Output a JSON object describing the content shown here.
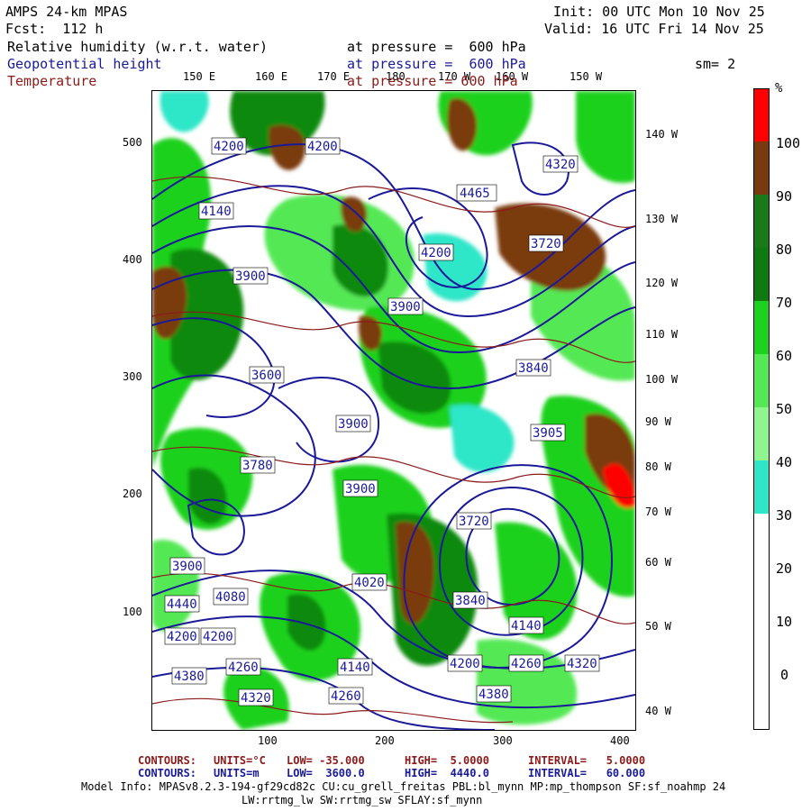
{
  "header": {
    "model": "AMPS 24-km MPAS",
    "fcst": "Fcst:  112 h",
    "init": "Init: 00 UTC Mon 10 Nov 25",
    "valid": "Valid: 16 UTC Fri 14 Nov 25",
    "field1": "Relative humidity (w.r.t. water)",
    "field1_level": "at pressure =  600 hPa",
    "field2": "Geopotential height",
    "field2_level": "at pressure =  600 hPa",
    "field3": "Temperature",
    "field3_level": "at pressure = 600 hPa",
    "smoothing": "sm= 2"
  },
  "colors": {
    "rh_30_40": "#2ee6c8",
    "rh_40_50": "#8ff58f",
    "rh_50_60": "#55e855",
    "rh_60_70": "#1fd11f",
    "rh_70_80": "#0f8a0f",
    "rh_80_90": "#1a7a1a",
    "rh_90_100": "#7a3a10",
    "rh_100": "#ff0000",
    "height_contour": "#1a1a99",
    "temp_contour": "#8b1a1a"
  },
  "colorbar": {
    "unit": "%",
    "ticks": [
      "100",
      "90",
      "80",
      "70",
      "60",
      "50",
      "40",
      "30",
      "20",
      "10",
      "0"
    ]
  },
  "top_lon_labels": [
    "150 E",
    "160 E",
    "170 E",
    "180",
    "170 W",
    "160 W",
    "150 W"
  ],
  "right_lon_labels": [
    "140 W",
    "130 W",
    "120 W",
    "110 W",
    "100 W",
    "90 W",
    "80 W",
    "70 W",
    "60 W",
    "50 W",
    "40 W"
  ],
  "y_axis_labels": [
    "500",
    "400",
    "300",
    "200",
    "100"
  ],
  "x_axis_labels": [
    "100",
    "200",
    "300",
    "400"
  ],
  "height_labels": [
    "4200",
    "4140",
    "4020",
    "3900",
    "3840",
    "3600",
    "3720",
    "3780",
    "4080",
    "4260",
    "4320",
    "4380",
    "4465",
    "3905",
    "4440",
    "4200",
    "4260",
    "4320"
  ],
  "footer": {
    "line1_label": "CONTOURS:",
    "line1_units": "UNITS=°C",
    "line1_low": "LOW= -35.000",
    "line1_high": "HIGH=  5.0000",
    "line1_interval": "INTERVAL=   5.0000",
    "line2_label": "CONTOURS:",
    "line2_units": "UNITS=m",
    "line2_low": "LOW=  3600.0",
    "line2_high": "HIGH=  4440.0",
    "line2_interval": "INTERVAL=   60.000",
    "model_info": "Model Info: MPASv8.2.3-194-gf29cd82c CU:cu_grell_freitas PBL:bl_mynn MP:mp_thompson SF:sf_noahmp 24",
    "model_info2": "LW:rrtmg_lw SW:rrtmg_sw SFLAY:sf_mynn"
  }
}
